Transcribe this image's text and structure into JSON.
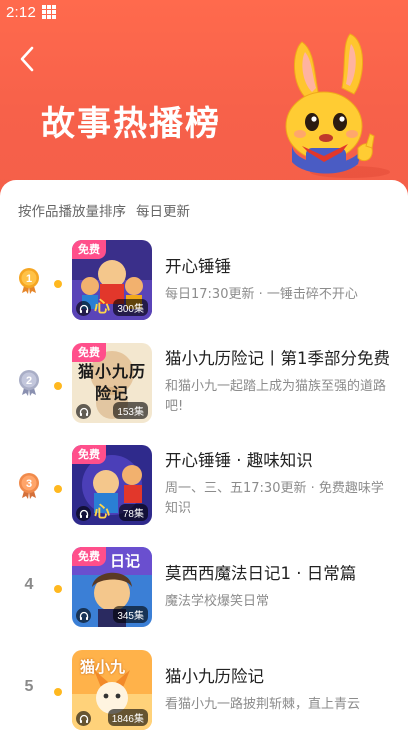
{
  "status_bar": {
    "time": "2:12"
  },
  "header": {
    "title": "故事热播榜",
    "back_icon": "back-arrow-icon"
  },
  "subtitle": {
    "sort_note": "按作品播放量排序",
    "update_note": "每日更新"
  },
  "colors": {
    "hero": "#f7614a",
    "dot": "#ffb81f",
    "free_badge": "#ff4f8b",
    "gold": "#f5a623",
    "silver": "#a9aec6",
    "bronze": "#f08a4b"
  },
  "ranking": [
    {
      "rank": "1",
      "medal": "gold",
      "badge": "免费",
      "count": "300集",
      "title": "开心锤锤",
      "desc": "每日17:30更新 · 一锤击碎不开心",
      "cover_text": "心"
    },
    {
      "rank": "2",
      "medal": "silver",
      "badge": "免费",
      "count": "153集",
      "title": "猫小九历险记丨第1季部分免费",
      "desc": "和猫小九一起踏上成为猫族至强的道路吧!",
      "cover_text": "猫小九历险记"
    },
    {
      "rank": "3",
      "medal": "bronze",
      "badge": "免费",
      "count": "78集",
      "title": "开心锤锤 · 趣味知识",
      "desc": "周一、三、五17:30更新 · 免费趣味学知识",
      "cover_text": "心"
    },
    {
      "rank": "4",
      "medal": "",
      "badge": "免费",
      "count": "345集",
      "title": "莫西西魔法日记1 · 日常篇",
      "desc": "魔法学校爆笑日常",
      "cover_text": "日记"
    },
    {
      "rank": "5",
      "medal": "",
      "badge": "",
      "count": "1846集",
      "title": "猫小九历险记",
      "desc": "看猫小九一路披荆斩棘，直上青云",
      "cover_text": "猫小九"
    }
  ]
}
